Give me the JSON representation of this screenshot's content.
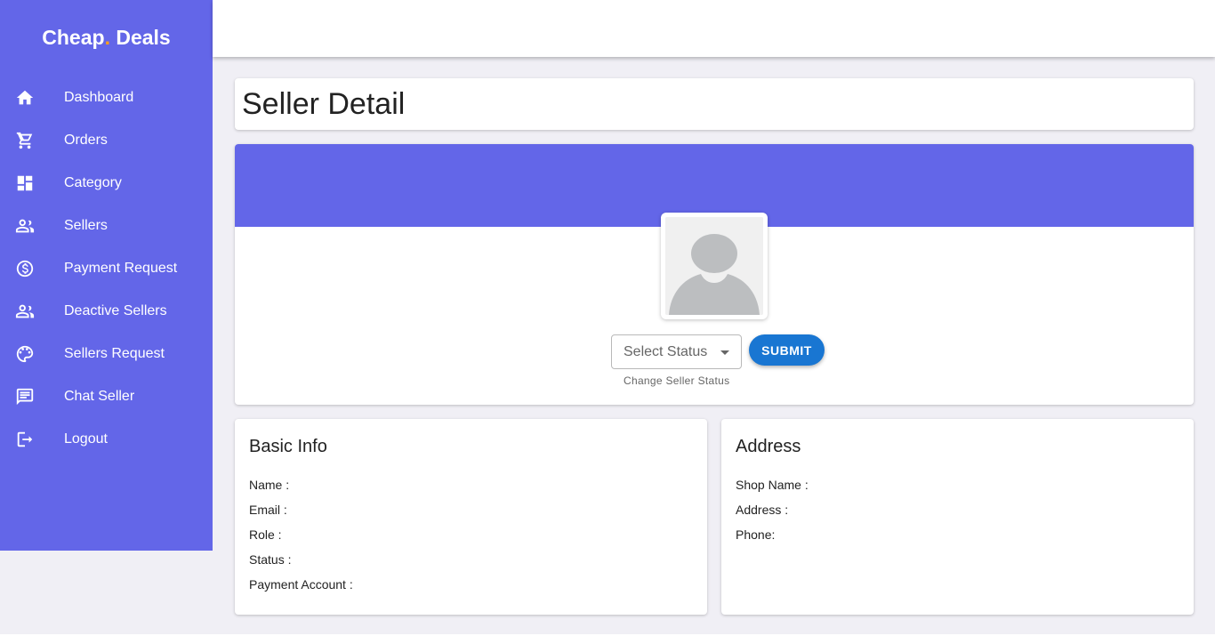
{
  "brand": {
    "part1": "Cheap",
    "dot": ".",
    "part2": " Deals"
  },
  "sidebar": {
    "items": [
      {
        "label": "Dashboard",
        "icon": "home-icon"
      },
      {
        "label": "Orders",
        "icon": "cart-icon"
      },
      {
        "label": "Category",
        "icon": "dashboard-grid-icon"
      },
      {
        "label": "Sellers",
        "icon": "people-icon"
      },
      {
        "label": "Payment Request",
        "icon": "dollar-circle-icon"
      },
      {
        "label": "Deactive Sellers",
        "icon": "people-icon"
      },
      {
        "label": "Sellers Request",
        "icon": "palette-icon"
      },
      {
        "label": "Chat Seller",
        "icon": "chat-icon"
      },
      {
        "label": "Logout",
        "icon": "logout-icon"
      }
    ]
  },
  "page": {
    "title": "Seller Detail"
  },
  "status": {
    "select_placeholder": "Select Status",
    "helper": "Change Seller Status",
    "submit_label": "SUBMIT"
  },
  "basic_info": {
    "heading": "Basic Info",
    "fields": [
      "Name :",
      "Email :",
      "Role :",
      "Status :",
      "Payment Account :"
    ]
  },
  "address": {
    "heading": "Address",
    "fields": [
      "Shop Name :",
      "Address :",
      "Phone:"
    ]
  },
  "colors": {
    "primary": "#6366e8",
    "accent": "#ff9f1c",
    "button": "#1976d2"
  }
}
